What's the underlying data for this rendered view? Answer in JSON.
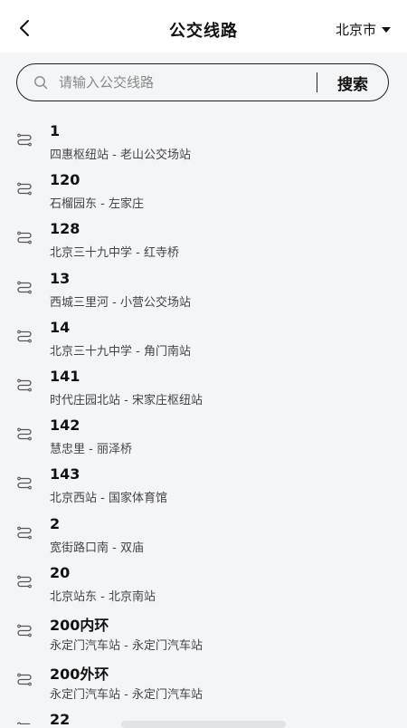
{
  "header": {
    "title": "公交线路",
    "city": "北京市"
  },
  "search": {
    "placeholder": "请输入公交线路",
    "value": "",
    "button_label": "搜索"
  },
  "routes": [
    {
      "name": "1",
      "stops": "四惠枢纽站 - 老山公交场站"
    },
    {
      "name": "120",
      "stops": "石榴园东 - 左家庄"
    },
    {
      "name": "128",
      "stops": "北京三十九中学 - 红寺桥"
    },
    {
      "name": "13",
      "stops": "西城三里河 - 小营公交场站"
    },
    {
      "name": "14",
      "stops": "北京三十九中学 - 角门南站"
    },
    {
      "name": "141",
      "stops": "时代庄园北站 - 宋家庄枢纽站"
    },
    {
      "name": "142",
      "stops": "慧忠里 - 丽泽桥"
    },
    {
      "name": "143",
      "stops": "北京西站 - 国家体育馆"
    },
    {
      "name": "2",
      "stops": "宽街路口南 - 双庙"
    },
    {
      "name": "20",
      "stops": "北京站东 - 北京南站"
    },
    {
      "name": "200内环",
      "stops": "永定门汽车站 - 永定门汽车站"
    },
    {
      "name": "200外环",
      "stops": "永定门汽车站 - 永定门汽车站"
    },
    {
      "name": "22",
      "stops": ""
    }
  ]
}
